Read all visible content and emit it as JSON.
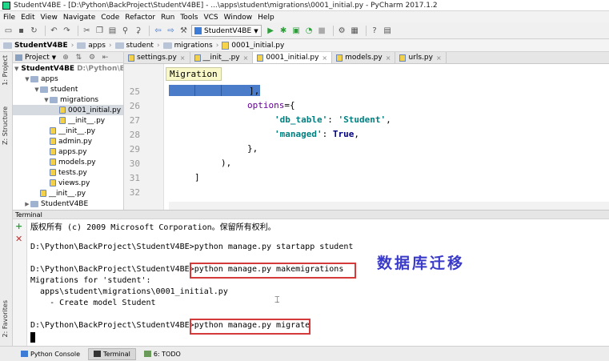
{
  "window": {
    "title": "StudentV4BE - [D:\\Python\\BackProject\\StudentV4BE] - ...\\apps\\student\\migrations\\0001_initial.py - PyCharm 2017.1.2"
  },
  "menu": [
    "File",
    "Edit",
    "View",
    "Navigate",
    "Code",
    "Refactor",
    "Run",
    "Tools",
    "VCS",
    "Window",
    "Help"
  ],
  "toolbar": {
    "run_config": "StudentV4BE"
  },
  "breadcrumb": [
    "StudentV4BE",
    "apps",
    "student",
    "migrations",
    "0001_initial.py"
  ],
  "left_strip": {
    "project_tab": "1: Project",
    "structure_tab": "Z: Structure",
    "favorites_tab": "2: Favorites"
  },
  "project_panel": {
    "header": "Project",
    "tree": [
      {
        "label": "StudentV4BE",
        "hint": "D:\\Python\\Ba",
        "type": "folder",
        "indent": 0,
        "bold": true,
        "arrow": "▼"
      },
      {
        "label": "apps",
        "type": "folder",
        "indent": 1,
        "arrow": "▼"
      },
      {
        "label": "student",
        "type": "folder",
        "indent": 2,
        "arrow": "▼"
      },
      {
        "label": "migrations",
        "type": "folder",
        "indent": 3,
        "arrow": "▼"
      },
      {
        "label": "0001_initial.py",
        "type": "py",
        "indent": 4,
        "selected": true
      },
      {
        "label": "__init__.py",
        "type": "py",
        "indent": 4
      },
      {
        "label": "__init__.py",
        "type": "py",
        "indent": 3
      },
      {
        "label": "admin.py",
        "type": "py",
        "indent": 3
      },
      {
        "label": "apps.py",
        "type": "py",
        "indent": 3
      },
      {
        "label": "models.py",
        "type": "py",
        "indent": 3
      },
      {
        "label": "tests.py",
        "type": "py",
        "indent": 3
      },
      {
        "label": "views.py",
        "type": "py",
        "indent": 3
      },
      {
        "label": "__init__.py",
        "type": "py",
        "indent": 2
      },
      {
        "label": "StudentV4BE",
        "type": "folder",
        "indent": 1,
        "arrow": "▶"
      }
    ]
  },
  "editor_tabs": [
    {
      "label": "settings.py",
      "active": false
    },
    {
      "label": "__init__.py",
      "active": false
    },
    {
      "label": "0001_initial.py",
      "active": true
    },
    {
      "label": "models.py",
      "active": false
    },
    {
      "label": "urls.py",
      "active": false
    }
  ],
  "editor": {
    "tooltip": "Migration",
    "line_numbers": [
      "25",
      "26",
      "27",
      "28",
      "29",
      "30",
      "31",
      "32"
    ],
    "code": {
      "l25": "],",
      "l26_kw": "options",
      "l26_rest": "={",
      "l27_key": "'db_table'",
      "l27_colon": ": ",
      "l27_val": "'Student'",
      "l27_end": ",",
      "l28_key": "'managed'",
      "l28_colon": ": ",
      "l28_val": "True",
      "l28_end": ",",
      "l29": "},",
      "l30": "),",
      "l31": "]"
    }
  },
  "terminal": {
    "header": "Terminal",
    "lines": [
      "版权所有 (c) 2009 Microsoft Corporation。保留所有权利。",
      "",
      "D:\\Python\\BackProject\\StudentV4BE>python manage.py startapp student",
      "",
      "D:\\Python\\BackProject\\StudentV4BE>python manage.py makemigrations",
      "Migrations for 'student':",
      "  apps\\student\\migrations\\0001_initial.py",
      "    - Create model Student",
      "",
      "D:\\Python\\BackProject\\StudentV4BE>python manage.py migrate"
    ],
    "annotation": "数据库迁移"
  },
  "statusbar": {
    "tabs": [
      {
        "label": "Python Console",
        "active": false
      },
      {
        "label": "Terminal",
        "active": true
      },
      {
        "label": "6: TODO",
        "active": false
      }
    ]
  }
}
